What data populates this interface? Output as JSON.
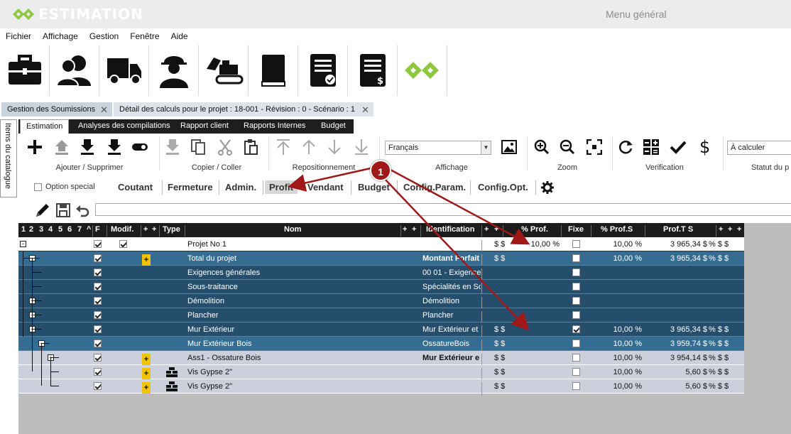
{
  "app": {
    "title": "ESTIMATION",
    "menu_general": "Menu général"
  },
  "menubar": [
    "Fichier",
    "Affichage",
    "Gestion",
    "Fenêtre",
    "Aide"
  ],
  "big_toolbar": [
    {
      "icon": "briefcase-icon"
    },
    {
      "icon": "contacts-icon"
    },
    {
      "icon": "truck-icon"
    },
    {
      "icon": "worker-icon"
    },
    {
      "icon": "excavator-icon"
    },
    {
      "icon": "book-icon"
    },
    {
      "icon": "document-check-icon"
    },
    {
      "icon": "invoice-icon"
    },
    {
      "icon": "logo-icon"
    }
  ],
  "doc_tabs": [
    {
      "label": "Gestion des Soumissions"
    },
    {
      "label": "Détail des calculs pour le projet : 18-001 - Révision : 0 - Scénario : 1"
    }
  ],
  "side_panel": "Items du catalogue",
  "ribbon_tabs": [
    "Estimation",
    "Analyses des compilations",
    "Rapport client",
    "Rapports Internes",
    "Budget"
  ],
  "ribbon_groups": {
    "add_remove": "Ajouter / Supprimer",
    "copy_paste": "Copier / Coller",
    "reposition": "Repositionnement",
    "display": "Affichage",
    "zoom": "Zoom",
    "verification": "Verification",
    "status": "Statut du p"
  },
  "language_select": "Français",
  "status_select": "À calculer",
  "option_special": "Option special",
  "view_tabs": [
    "Coutant",
    "Fermeture",
    "Admin.",
    "Profit",
    "Vendant",
    "Budget",
    "Config.Param.",
    "Config.Opt."
  ],
  "selected_view": "Profit",
  "annotation": "1",
  "grid": {
    "levels": [
      "1",
      "2",
      "3",
      "4",
      "5",
      "6",
      "7"
    ],
    "headers": {
      "sort": "^",
      "f": "F",
      "modif": "Modif.",
      "plus": "+",
      "type": "Type",
      "nom": "Nom",
      "ident": "Identification",
      "pct_prof": "% Prof.",
      "fixe": "Fixe",
      "pct_profs": "% Prof.S",
      "proft": "Prof.T S"
    },
    "rows": [
      {
        "nom": "Projet No 1",
        "ident": "",
        "money": "$  $",
        "pct_prof": "10,00 %",
        "pct_profs": "10,00 %",
        "proft": "3 965,34 $",
        "tail": "%  $  $"
      },
      {
        "nom": "Total du projet",
        "ident": "Montant Forfait",
        "money": "$  $",
        "pct_prof": "",
        "pct_profs": "10,00 %",
        "proft": "3 965,34 $",
        "tail": "%  $  $"
      },
      {
        "nom": "Exigences générales",
        "ident": "00 01 - Exigence",
        "money": "",
        "pct_prof": "",
        "pct_profs": "",
        "proft": "",
        "tail": ""
      },
      {
        "nom": "Sous-traitance",
        "ident": "Spécialités en So",
        "money": "",
        "pct_prof": "",
        "pct_profs": "",
        "proft": "",
        "tail": ""
      },
      {
        "nom": "Démolition",
        "ident": "Démolition",
        "money": "",
        "pct_prof": "",
        "pct_profs": "",
        "proft": "",
        "tail": ""
      },
      {
        "nom": "Plancher",
        "ident": "Plancher",
        "money": "",
        "pct_prof": "",
        "pct_profs": "",
        "proft": "",
        "tail": ""
      },
      {
        "nom": "Mur Extérieur",
        "ident": "Mur Extérieur et",
        "money": "$  $",
        "pct_prof": "",
        "pct_profs": "10,00 %",
        "proft": "3 965,34 $",
        "tail": "%  $  $"
      },
      {
        "nom": "Mur Extérieur Bois",
        "ident": "OssatureBois",
        "money": "$  $",
        "pct_prof": "",
        "pct_profs": "10,00 %",
        "proft": "3 959,74 $",
        "tail": "%  $  $"
      },
      {
        "nom": "Ass1 - Ossature Bois",
        "ident": "Mur Extérieur e",
        "money": "$  $",
        "pct_prof": "",
        "pct_profs": "10,00 %",
        "proft": "3 954,14 $",
        "tail": "%  $  $"
      },
      {
        "nom": "Vis Gypse 2\"",
        "ident": "",
        "money": "$  $",
        "pct_prof": "",
        "pct_profs": "10,00 %",
        "proft": "5,60 $",
        "tail": "%  $  $"
      },
      {
        "nom": "Vis Gypse 2\"",
        "ident": "",
        "money": "$  $",
        "pct_prof": "",
        "pct_profs": "10,00 %",
        "proft": "5,60 $",
        "tail": "%  $  $"
      }
    ]
  },
  "colors": {
    "accent_green": "#8dc63f",
    "row_blue": "#356d92",
    "row_dark": "#244e6c",
    "arrow_red": "#a01818"
  }
}
